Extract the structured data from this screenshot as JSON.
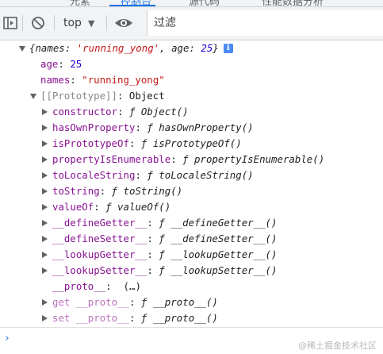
{
  "top_tabs": [
    "元素",
    "控制台",
    "源代码",
    "性能数据分析"
  ],
  "toolbar": {
    "context_label": "top",
    "caret": "▼",
    "filter_placeholder": "过滤"
  },
  "console": {
    "summary": {
      "open": "{",
      "k1": "names",
      "v1": "'running_yong'",
      "k2": "age",
      "v2": "25",
      "close": "}",
      "info": "i"
    },
    "age": {
      "key": "age",
      "value": "25"
    },
    "names": {
      "key": "names",
      "value": "\"running_yong\""
    },
    "prototype": {
      "key": "[[Prototype]]",
      "value": "Object"
    },
    "members": [
      {
        "key": "constructor",
        "func": "ƒ Object()"
      },
      {
        "key": "hasOwnProperty",
        "func": "ƒ hasOwnProperty()"
      },
      {
        "key": "isPrototypeOf",
        "func": "ƒ isPrototypeOf()"
      },
      {
        "key": "propertyIsEnumerable",
        "func": "ƒ propertyIsEnumerable()"
      },
      {
        "key": "toLocaleString",
        "func": "ƒ toLocaleString()"
      },
      {
        "key": "toString",
        "func": "ƒ toString()"
      },
      {
        "key": "valueOf",
        "func": "ƒ valueOf()"
      },
      {
        "key": "__defineGetter__",
        "func": "ƒ __defineGetter__()"
      },
      {
        "key": "__defineSetter__",
        "func": "ƒ __defineSetter__()"
      },
      {
        "key": "__lookupGetter__",
        "func": "ƒ __lookupGetter__()"
      },
      {
        "key": "__lookupSetter__",
        "func": "ƒ __lookupSetter__()"
      }
    ],
    "proto": {
      "key": "__proto__",
      "value": "(…)"
    },
    "getter": {
      "key": "get __proto__",
      "func": "ƒ __proto__()"
    },
    "setter": {
      "key": "set __proto__",
      "func": "ƒ __proto__()"
    },
    "prompt": "›"
  },
  "watermark": "@稀土掘金技术社区"
}
